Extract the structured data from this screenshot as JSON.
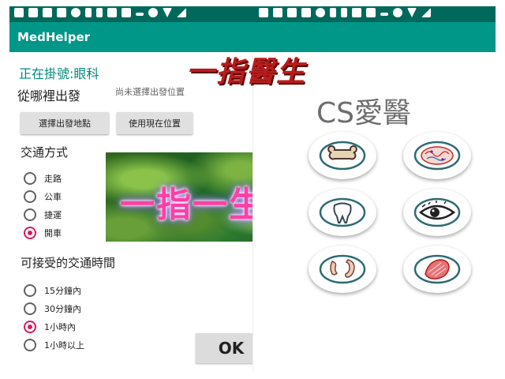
{
  "app": {
    "title": "MedHelper"
  },
  "overlay": {
    "title": "一指醫生"
  },
  "registration": {
    "status": "正在掛號:眼科"
  },
  "origin": {
    "label": "從哪裡出發",
    "status": "尚未選擇出發位置",
    "choose_button": "選擇出發地點",
    "current_button": "使用現在位置"
  },
  "transport": {
    "label": "交通方式",
    "options": [
      {
        "label": "走路",
        "selected": false
      },
      {
        "label": "公車",
        "selected": false
      },
      {
        "label": "捷運",
        "selected": false
      },
      {
        "label": "開車",
        "selected": true
      }
    ]
  },
  "banner": {
    "text": "一指一生"
  },
  "travel_time": {
    "label": "可接受的交通時間",
    "options": [
      {
        "label": "15分鐘內",
        "selected": false
      },
      {
        "label": "30分鐘內",
        "selected": false
      },
      {
        "label": "1小時內",
        "selected": true
      },
      {
        "label": "1小時以上",
        "selected": false
      }
    ]
  },
  "ok_button": "OK",
  "right_panel": {
    "title": "CS愛醫",
    "icons": [
      "bone-icon",
      "brain-icon",
      "tooth-icon",
      "eye-icon",
      "ear-nose-icon",
      "muscle-icon"
    ]
  },
  "colors": {
    "status_bar": "#00695c",
    "app_bar": "#009688",
    "accent": "#d81b60",
    "heading": "#00897b"
  }
}
